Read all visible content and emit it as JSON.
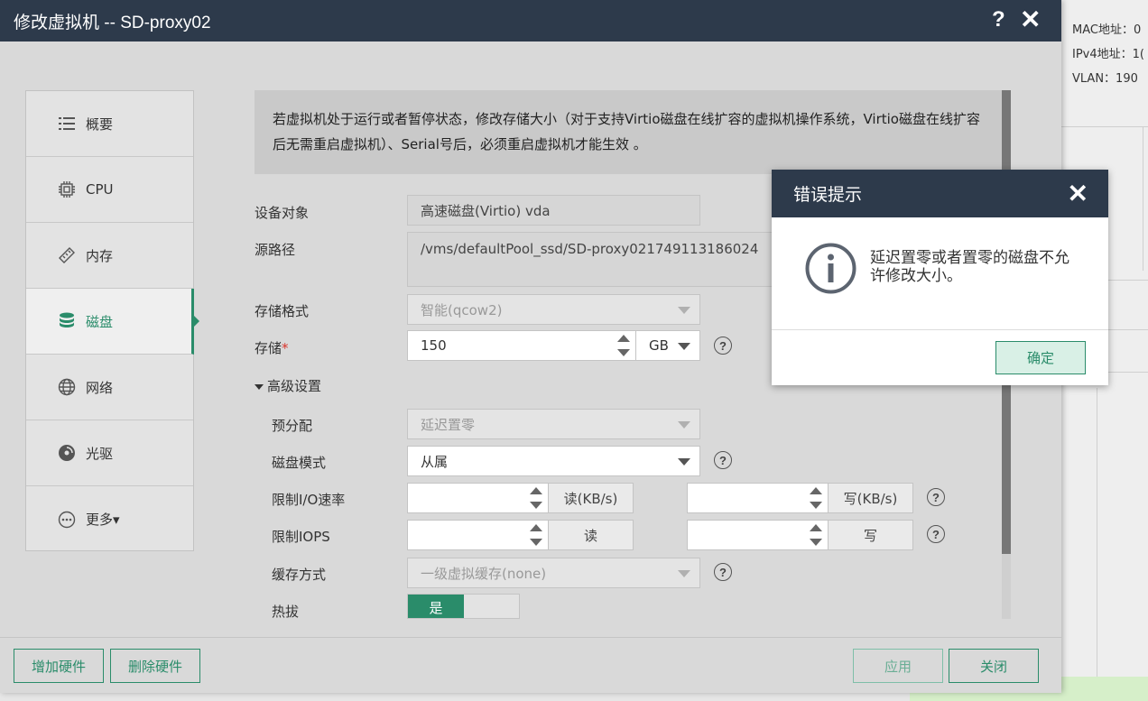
{
  "background_page": {
    "mac_label": "MAC地址：0",
    "ipv4_label": "IPv4地址：1(",
    "vlan_label": "VLAN：190"
  },
  "modal": {
    "title": "修改虚拟机 -- SD-proxy02",
    "help": "?",
    "close": "✕"
  },
  "nav": {
    "items": [
      {
        "label": "概要",
        "icon": "list-icon"
      },
      {
        "label": "CPU",
        "icon": "chip-icon"
      },
      {
        "label": "内存",
        "icon": "memory-icon"
      },
      {
        "label": "磁盘",
        "icon": "database-icon",
        "active": true
      },
      {
        "label": "网络",
        "icon": "globe-icon"
      },
      {
        "label": "光驱",
        "icon": "disc-icon"
      },
      {
        "label": "更多▾",
        "icon": "more-icon"
      }
    ]
  },
  "notice": "若虚拟机处于运行或者暂停状态，修改存储大小（对于支持Virtio磁盘在线扩容的虚拟机操作系统，Virtio磁盘在线扩容后无需重启虚拟机）、Serial号后，必须重启虚拟机才能生效 。",
  "form": {
    "device_label": "设备对象",
    "device_value": "高速磁盘(Virtio) vda",
    "source_label": "源路径",
    "source_value": "/vms/defaultPool_ssd/SD-proxy021749113186024",
    "format_label": "存储格式",
    "format_value": "智能(qcow2)",
    "storage_label": "存储",
    "storage_required": "*",
    "storage_value": "150",
    "storage_unit": "GB",
    "advanced_label": "高级设置",
    "prealloc_label": "预分配",
    "prealloc_value": "延迟置零",
    "disk_mode_label": "磁盘模式",
    "disk_mode_value": "从属",
    "io_rate_label": "限制I/O速率",
    "io_read_unit": "读(KB/s)",
    "io_write_unit": "写(KB/s)",
    "iops_label": "限制IOPS",
    "iops_read_unit": "读",
    "iops_write_unit": "写",
    "cache_label": "缓存方式",
    "cache_value": "一级虚拟缓存(none)",
    "hotplug_label": "热拔",
    "hotplug_value": "是",
    "help_glyph": "?"
  },
  "footer": {
    "add_hw": "增加硬件",
    "del_hw": "删除硬件",
    "apply": "应用",
    "close": "关闭"
  },
  "dialog": {
    "title": "错误提示",
    "close": "✕",
    "message": "延迟置零或者置零的磁盘不允许修改大小。",
    "ok": "确定",
    "icon": "info-circle-icon"
  },
  "colors": {
    "header_bg": "#2d3a4b",
    "accent": "#2a8c6a",
    "modal_bg": "#d9d9d9"
  }
}
